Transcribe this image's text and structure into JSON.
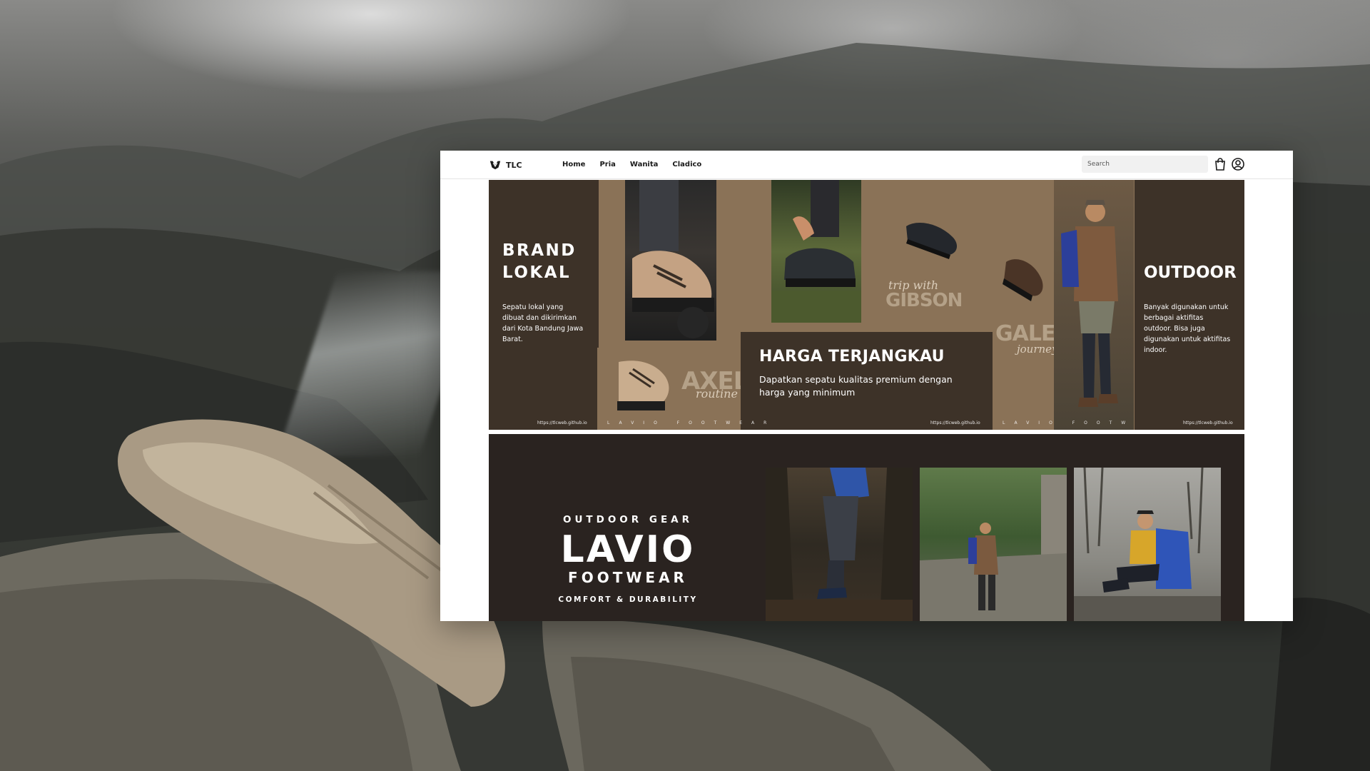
{
  "navbar": {
    "brand": "TLC",
    "links": [
      "Home",
      "Pria",
      "Wanita",
      "Cladico"
    ],
    "search_placeholder": "Search"
  },
  "hero": {
    "brand_title_line1": "BRAND",
    "brand_title_line2": "LOKAL",
    "brand_text": "Sepatu lokal yang dibuat dan dikirimkan dari Kota Bandung Jawa Barat.",
    "promo_title": "HARGA TERJANGKAU",
    "promo_text": "Dapatkan sepatu kualitas premium dengan harga yang minimum",
    "outdoor_title": "OUTDOOR",
    "outdoor_text": "Banyak digunakan untuk berbagai aktifitas outdoor. Bisa juga digunakan untuk aktifitas indoor.",
    "url": "https://tlcweb.github.io",
    "footer_strip": "LAVIO FOOTWEAR",
    "axel_word": "AXEL",
    "axel_script": "routine",
    "trip_script": "trip with",
    "gibson_word": "GIBSON",
    "galen_word": "GALEN",
    "galen_script": "journey"
  },
  "banner2": {
    "kicker": "OUTDOOR GEAR",
    "title": "LAVIO",
    "subtitle": "FOOTWEAR",
    "tagline": "COMFORT & DURABILITY"
  },
  "colors": {
    "brown_dark": "#3d3228",
    "brown_mid": "#8a7257",
    "banner2_bg": "#2a2320"
  },
  "icons": [
    "tlc-logo-icon",
    "shopping-bag-icon",
    "user-circle-icon"
  ]
}
